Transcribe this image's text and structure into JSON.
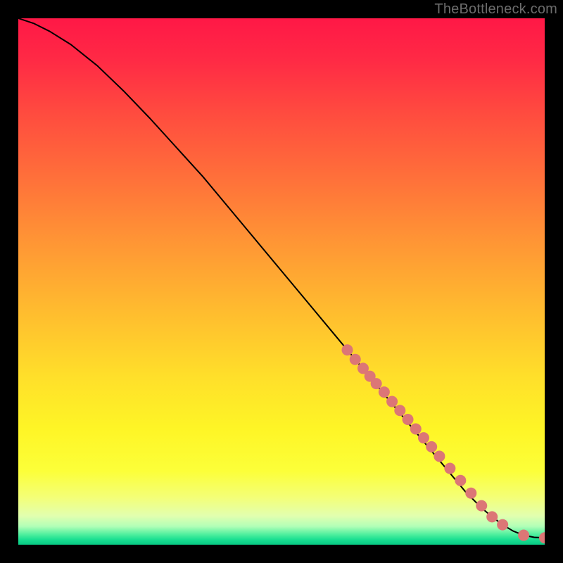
{
  "watermark": {
    "text": "TheBottleneck.com"
  },
  "gradient": {
    "stops": [
      {
        "offset": 0.0,
        "color": "#ff1846"
      },
      {
        "offset": 0.08,
        "color": "#ff2a45"
      },
      {
        "offset": 0.18,
        "color": "#ff4b3f"
      },
      {
        "offset": 0.3,
        "color": "#ff6f3a"
      },
      {
        "offset": 0.42,
        "color": "#ff9435"
      },
      {
        "offset": 0.55,
        "color": "#ffba2f"
      },
      {
        "offset": 0.68,
        "color": "#ffdf2a"
      },
      {
        "offset": 0.78,
        "color": "#fef526"
      },
      {
        "offset": 0.86,
        "color": "#fcff39"
      },
      {
        "offset": 0.91,
        "color": "#f4ff77"
      },
      {
        "offset": 0.945,
        "color": "#e2ffaf"
      },
      {
        "offset": 0.965,
        "color": "#b2ffb7"
      },
      {
        "offset": 0.98,
        "color": "#52f09f"
      },
      {
        "offset": 0.99,
        "color": "#1adf91"
      },
      {
        "offset": 1.0,
        "color": "#08c884"
      }
    ]
  },
  "chart_data": {
    "type": "line",
    "title": "",
    "xlabel": "",
    "ylabel": "",
    "xlim": [
      0,
      100
    ],
    "ylim": [
      0,
      100
    ],
    "grid": false,
    "series": [
      {
        "name": "curve",
        "x": [
          0,
          3,
          6,
          10,
          15,
          20,
          25,
          30,
          35,
          40,
          45,
          50,
          55,
          60,
          65,
          70,
          75,
          80,
          85,
          88,
          90,
          92,
          94,
          96,
          98,
          100
        ],
        "y": [
          100,
          99,
          97.5,
          95,
          91,
          86.2,
          81,
          75.5,
          70,
          64,
          58,
          52,
          46,
          40,
          34,
          28,
          22,
          16,
          10,
          7,
          5.3,
          3.8,
          2.6,
          1.8,
          1.4,
          1.3
        ]
      }
    ],
    "markers": {
      "name": "highlight-points",
      "x": [
        62.5,
        64.0,
        65.5,
        66.8,
        68.0,
        69.5,
        71.0,
        72.5,
        74.0,
        75.5,
        77.0,
        78.5,
        80.0,
        82.0,
        84.0,
        86.0,
        88.0,
        90.0,
        92.0,
        96.0,
        100.0
      ],
      "y": [
        37.0,
        35.2,
        33.5,
        32.0,
        30.6,
        29.0,
        27.2,
        25.5,
        23.8,
        22.0,
        20.3,
        18.6,
        16.8,
        14.5,
        12.2,
        9.8,
        7.4,
        5.3,
        3.8,
        1.8,
        1.3
      ]
    },
    "annotations": []
  }
}
